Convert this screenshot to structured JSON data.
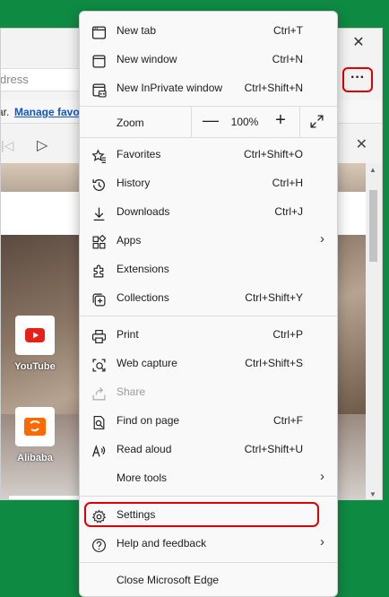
{
  "browser": {
    "address_placeholder": "dress",
    "more_button_label": "···",
    "favorites_prefix": "ar.",
    "manage_favorites_label": "Manage favo",
    "tiles": [
      {
        "label": "YouTube",
        "color": "#e62117"
      },
      {
        "label": "Alibaba",
        "color": "#ff6a00"
      }
    ]
  },
  "menu": {
    "items": [
      {
        "label": "New tab",
        "shortcut": "Ctrl+T",
        "icon": "new-tab-icon"
      },
      {
        "label": "New window",
        "shortcut": "Ctrl+N",
        "icon": "new-window-icon"
      },
      {
        "label": "New InPrivate window",
        "shortcut": "Ctrl+Shift+N",
        "icon": "inprivate-icon"
      }
    ],
    "zoom": {
      "label": "Zoom",
      "minus": "—",
      "value": "100%",
      "plus": "+"
    },
    "items2": [
      {
        "label": "Favorites",
        "shortcut": "Ctrl+Shift+O",
        "icon": "favorites-icon"
      },
      {
        "label": "History",
        "shortcut": "Ctrl+H",
        "icon": "history-icon"
      },
      {
        "label": "Downloads",
        "shortcut": "Ctrl+J",
        "icon": "download-icon"
      },
      {
        "label": "Apps",
        "shortcut": "",
        "icon": "apps-icon"
      },
      {
        "label": "Extensions",
        "shortcut": "",
        "icon": "extensions-icon"
      },
      {
        "label": "Collections",
        "shortcut": "Ctrl+Shift+Y",
        "icon": "collections-icon"
      }
    ],
    "items3": [
      {
        "label": "Print",
        "shortcut": "Ctrl+P",
        "icon": "print-icon"
      },
      {
        "label": "Web capture",
        "shortcut": "Ctrl+Shift+S",
        "icon": "web-capture-icon"
      },
      {
        "label": "Share",
        "shortcut": "",
        "icon": "share-icon"
      },
      {
        "label": "Find on page",
        "shortcut": "Ctrl+F",
        "icon": "find-icon"
      },
      {
        "label": "Read aloud",
        "shortcut": "Ctrl+Shift+U",
        "icon": "read-aloud-icon"
      },
      {
        "label": "More tools",
        "shortcut": "",
        "icon": ""
      }
    ],
    "items4": [
      {
        "label": "Settings",
        "shortcut": "",
        "icon": "settings-icon"
      },
      {
        "label": "Help and feedback",
        "shortcut": "",
        "icon": "help-icon"
      }
    ],
    "close_label": "Close Microsoft Edge"
  },
  "colors": {
    "highlight": "#e00000",
    "background": "#0f8a43"
  }
}
